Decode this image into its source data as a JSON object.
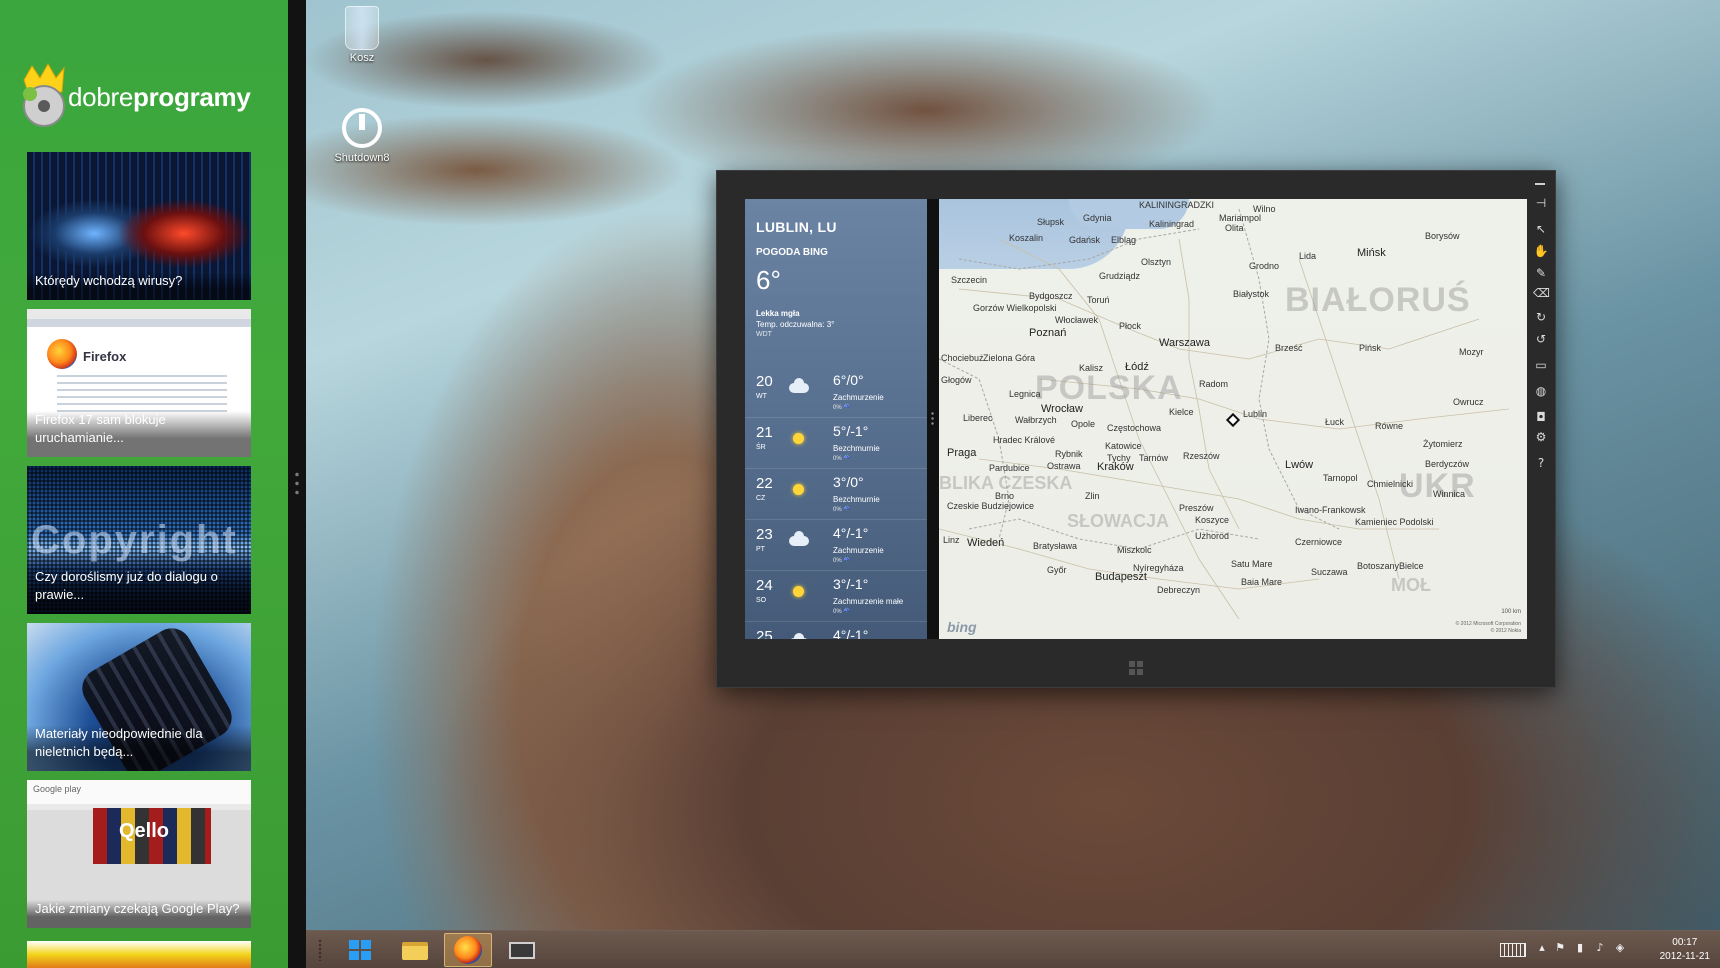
{
  "sidebar": {
    "logo": {
      "text_light": "dobre",
      "text_bold": "programy"
    },
    "news": [
      {
        "title": "Którędy wchodzą wirusy?"
      },
      {
        "title": "Firefox 17 sam blokuje uruchamianie..."
      },
      {
        "title": "Czy doroślismy już do dialogu o prawie..."
      },
      {
        "title": "Materiały nieodpowiednie dla nieletnich będą..."
      },
      {
        "title": "Jakie zmiany czekają Google Play?"
      }
    ],
    "thumb_text": {
      "firefox": "Firefox",
      "copyright": "Copyright",
      "google_play": "Google play",
      "qello": "Qello"
    }
  },
  "desktop": {
    "icons": [
      {
        "label": "Kosz",
        "icon": "recycle-bin-icon"
      },
      {
        "label": "Shutdown8",
        "icon": "power-icon"
      }
    ]
  },
  "weather": {
    "city": "LUBLIN, LU",
    "source": "POGODA BING",
    "current_temp": "6°",
    "condition": "Lekka mgła",
    "feels_like": "Temp. odczuwalna: 3°",
    "station": "WDT",
    "forecast": [
      {
        "day": "20",
        "abbr": "WT",
        "temp": "6°/0°",
        "desc": "Zachmurzenie",
        "precip": "0% ☔",
        "icon": "cloud"
      },
      {
        "day": "21",
        "abbr": "ŚR",
        "temp": "5°/-1°",
        "desc": "Bezchmurnie",
        "precip": "0% ☔",
        "icon": "sun"
      },
      {
        "day": "22",
        "abbr": "CZ",
        "temp": "3°/0°",
        "desc": "Bezchmurnie",
        "precip": "0% ☔",
        "icon": "sun"
      },
      {
        "day": "23",
        "abbr": "PT",
        "temp": "4°/-1°",
        "desc": "Zachmurzenie",
        "precip": "0% ☔",
        "icon": "cloud"
      },
      {
        "day": "24",
        "abbr": "SO",
        "temp": "3°/-1°",
        "desc": "Zachmurzenie małe",
        "precip": "0% ☔",
        "icon": "sun"
      },
      {
        "day": "25",
        "abbr": "",
        "temp": "4°/-1°",
        "desc": "",
        "precip": "",
        "icon": "cloud"
      }
    ]
  },
  "map": {
    "countries": [
      "BIAŁORUŚ",
      "POLSKA",
      "UKR",
      "SŁOWACJA",
      "BLIKA CZESKA",
      "MOŁ"
    ],
    "cities": [
      "Kaliningrad",
      "KALININGRADZKI",
      "Wilno",
      "Mariampol",
      "Olita",
      "Słupsk",
      "Gdynia",
      "Gdańsk",
      "Elbląg",
      "Koszalin",
      "Olsztyn",
      "Grodno",
      "Lida",
      "Mińsk",
      "Borysów",
      "Szczecin",
      "Grudziądz",
      "Bydgoszcz",
      "Toruń",
      "Białystok",
      "Gorzów Wielkopolski",
      "Włocławek",
      "Płock",
      "Poznań",
      "Warszawa",
      "Brześć",
      "Pińsk",
      "Mozyr",
      "Zielona Góra",
      "Kalisz",
      "Łódź",
      "Radom",
      "Lublin",
      "Głogów",
      "Legnica",
      "Wrocław",
      "Kielce",
      "Łuck",
      "Równe",
      "Owrucz",
      "Liberec",
      "Wałbrzych",
      "Opole",
      "Częstochowa",
      "Praga",
      "Hradec Králové",
      "Katowice",
      "Tychy",
      "Tarnów",
      "Rzeszów",
      "Lwów",
      "Żytomierz",
      "Berdyczów",
      "Ostrawa",
      "Rybnik",
      "Kraków",
      "Pardubice",
      "Brno",
      "Zlin",
      "Tarnopol",
      "Chmielnicki",
      "Winnica",
      "Iwano-Frankowsk",
      "Koszyce",
      "Preszów",
      "Użhorod",
      "Kamieniec Podolski",
      "Wiedeń",
      "Bratysława",
      "Miszkolc",
      "Nyíregyháza",
      "Czerniowce",
      "Győr",
      "Budapeszt",
      "Debreczyn",
      "Satu Mare",
      "Baia Mare",
      "Suczawa",
      "Botoszany",
      "Bielce",
      "Linz",
      "Czeskie Budziejowice",
      "Chociebuż"
    ],
    "pin_label": "Lublin",
    "bing": "bing",
    "scale": "100 km",
    "copyright": [
      "© 2012 Microsoft Corporation",
      "© 2012 Nokia"
    ]
  },
  "taskbar": {
    "apps": [
      {
        "name": "start",
        "icon": "windows-icon"
      },
      {
        "name": "explorer",
        "icon": "folder-icon"
      },
      {
        "name": "firefox",
        "icon": "firefox-icon"
      },
      {
        "name": "desktop",
        "icon": "monitor-icon"
      }
    ],
    "clock": {
      "time": "00:17",
      "date": "2012-11-21"
    }
  },
  "colors": {
    "sidebar_green": "#3aa63d",
    "weather_pane": "#5c7494",
    "window_frame": "#2a2a2a"
  }
}
